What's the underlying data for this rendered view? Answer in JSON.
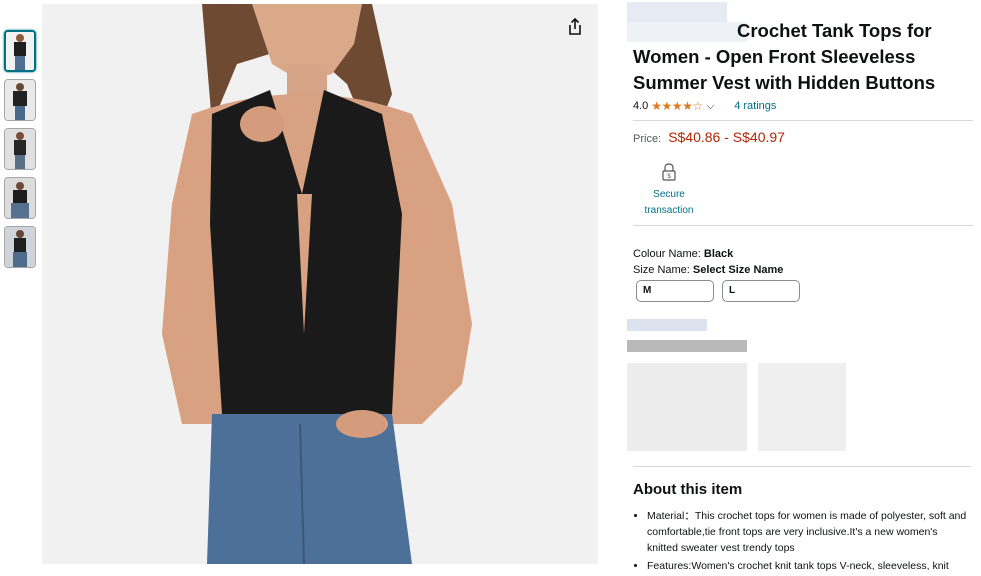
{
  "product": {
    "title_visible": "Crochet Tank Tops for Women - Open Front Sleeveless Summer Vest with Hidden Buttons",
    "rating_value": "4.0",
    "stars": "★★★★☆",
    "ratings_count": "4 ratings",
    "price_label": "Price:",
    "price": "S$40.86 - S$40.97",
    "secure_line1": "Secure",
    "secure_line2": "transaction",
    "colour_label": "Colour Name:",
    "colour_value": "Black",
    "size_label": "Size Name:",
    "size_value": "Select Size Name",
    "sizes": [
      "M",
      "L"
    ]
  },
  "about": {
    "heading": "About this item",
    "bullets": [
      "Material：This crochet tops for women is made of polyester, soft and comfortable,tie front tops are very inclusive.It's a new women's knitted sweater vest trendy tops",
      "Features:Women's crochet knit tank tops V-neck, sleeveless, knit"
    ]
  },
  "icons": {
    "share": "share-icon",
    "lock": "lock-icon",
    "chevron": "chevron-down-icon"
  },
  "colors": {
    "link": "#007185",
    "price": "#b12704",
    "star": "#de7921"
  }
}
